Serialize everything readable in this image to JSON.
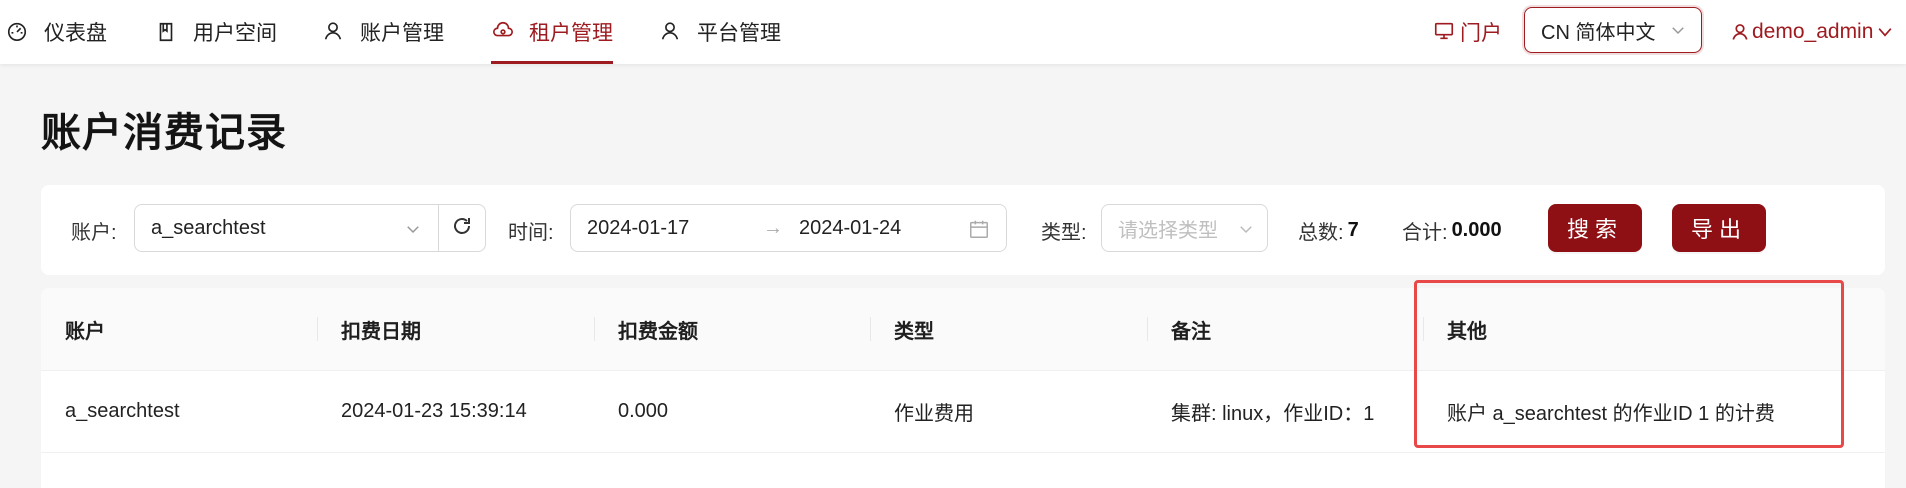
{
  "nav": {
    "items": [
      {
        "label": "仪表盘",
        "icon": "dashboard-icon"
      },
      {
        "label": "用户空间",
        "icon": "book-icon"
      },
      {
        "label": "账户管理",
        "icon": "user-icon"
      },
      {
        "label": "租户管理",
        "icon": "cloud-icon"
      },
      {
        "label": "平台管理",
        "icon": "user-icon"
      }
    ],
    "active": "租户管理",
    "portal_label": "门户",
    "language": "CN 简体中文",
    "username": "demo_admin"
  },
  "page": {
    "title": "账户消费记录"
  },
  "filters": {
    "account_label": "账户:",
    "account_value": "a_searchtest",
    "time_label": "时间:",
    "date_start": "2024-01-17",
    "date_end": "2024-01-24",
    "type_label": "类型:",
    "type_placeholder": "请选择类型",
    "count_label": "总数:",
    "count_value": "7",
    "sum_label": "合计:",
    "sum_value": "0.000",
    "search_label": "搜索",
    "export_label": "导出"
  },
  "table": {
    "columns": [
      "账户",
      "扣费日期",
      "扣费金额",
      "类型",
      "备注",
      "其他"
    ],
    "rows": [
      [
        "a_searchtest",
        "2024-01-23 15:39:14",
        "0.000",
        "作业费用",
        "集群: linux，作业ID：1",
        "账户 a_searchtest 的作业ID 1 的计费"
      ]
    ]
  },
  "colors": {
    "accent": "#9e1b20",
    "button": "#8e0f14",
    "highlight": "#e84848"
  }
}
